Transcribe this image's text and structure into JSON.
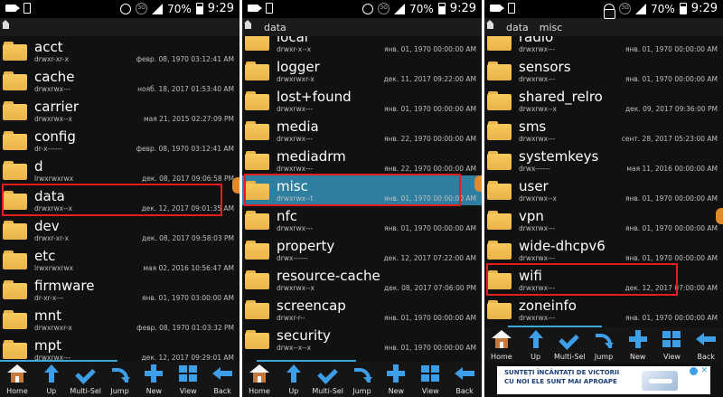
{
  "status": {
    "battery": "70%",
    "time": "9:29",
    "nosig_label": "3G"
  },
  "toolbar": {
    "home": "Home",
    "up": "Up",
    "multisel": "Multi-Sel",
    "jump": "Jump",
    "new": "New",
    "view": "View",
    "back": "Back"
  },
  "panels": [
    {
      "breadcrumbs": [],
      "rows": [
        {
          "name": "acct",
          "perm": "drwxr-xr-x",
          "date": "февр. 08, 1970 03:12:41 AM"
        },
        {
          "name": "cache",
          "perm": "drwxrwx---",
          "date": "нояб. 18, 2017 01:53:40 AM"
        },
        {
          "name": "carrier",
          "perm": "drwxrwx--x",
          "date": "мая 21, 2015 02:27:09 PM"
        },
        {
          "name": "config",
          "perm": "dr-x------",
          "date": "февр. 08, 1970 03:12:41 AM"
        },
        {
          "name": "d",
          "perm": "lrwxrwxrwx",
          "date": "дек. 08, 2017 09:06:58 PM"
        },
        {
          "name": "data",
          "perm": "drwxrwx--x",
          "date": "дек. 12, 2017 09:01:35 AM"
        },
        {
          "name": "dev",
          "perm": "drwxr-xr-x",
          "date": "дек. 08, 2017 09:58:03 PM"
        },
        {
          "name": "etc",
          "perm": "lrwxrwxrwx",
          "date": "мая 02, 2016 10:56:47 AM"
        },
        {
          "name": "firmware",
          "perm": "dr-xr-x---",
          "date": "янв. 01, 1970 03:00:00 AM"
        },
        {
          "name": "mnt",
          "perm": "drwxrwxr-x",
          "date": "февр. 08, 1970 01:03:32 PM"
        },
        {
          "name": "mpt",
          "perm": "drwxrwx---",
          "date": "дек. 12, 2017 09:29:01 AM"
        }
      ]
    },
    {
      "breadcrumbs": [
        "data"
      ],
      "rows": [
        {
          "name": "local",
          "perm": "drwxr-x--x",
          "date": "янв. 01, 1970 00:00:00 AM"
        },
        {
          "name": "logger",
          "perm": "drwxrwxr-x",
          "date": "дек. 11, 2017 09:22:00 AM"
        },
        {
          "name": "lost+found",
          "perm": "drwxrwx---",
          "date": "янв. 01, 1970 00:00:00 AM"
        },
        {
          "name": "media",
          "perm": "drwxrwx---",
          "date": "янв. 22, 1970 00:00:00 AM"
        },
        {
          "name": "mediadrm",
          "perm": "drwxrwx---",
          "date": "янв. 22, 1970 00:00:00 AM"
        },
        {
          "name": "misc",
          "perm": "drwxrwx--t",
          "date": "янв. 01, 1970 00:00:00 AM"
        },
        {
          "name": "nfc",
          "perm": "drwxrwx---",
          "date": "янв. 01, 1970 00:00:00 AM"
        },
        {
          "name": "property",
          "perm": "drwx------",
          "date": "дек. 12, 2017 07:22:00 AM"
        },
        {
          "name": "resource-cache",
          "perm": "drwxrwx--x",
          "date": "дек. 08, 2017 07:06:00 PM"
        },
        {
          "name": "screencap",
          "perm": "drwxr-r--",
          "date": "янв. 01, 1970 00:00:00 AM"
        },
        {
          "name": "security",
          "perm": "drwx--x--x",
          "date": "янв. 01, 1970 00:00:00 AM"
        }
      ]
    },
    {
      "breadcrumbs": [
        "data",
        "misc"
      ],
      "rows": [
        {
          "name": "radio",
          "perm": "drwxrwx---",
          "date": "янв. 01, 1970 00:00:00 AM"
        },
        {
          "name": "sensors",
          "perm": "drwxrwx---",
          "date": "янв. 01, 1970 00:00:00 AM"
        },
        {
          "name": "shared_relro",
          "perm": "drwxrwx--x",
          "date": "дек. 09, 2017 09:36:00 PM"
        },
        {
          "name": "sms",
          "perm": "drwxrwx---",
          "date": "сент. 28, 2017 05:23:00 AM"
        },
        {
          "name": "systemkeys",
          "perm": "drwx------",
          "date": "мая 11, 2016 00:00:00 AM"
        },
        {
          "name": "user",
          "perm": "drwxrwx--x",
          "date": "янв. 01, 1970 00:00:00 AM"
        },
        {
          "name": "vpn",
          "perm": "drwxrwx---",
          "date": "янв. 01, 1970 00:00:00 AM"
        },
        {
          "name": "wide-dhcpv6",
          "perm": "drwxrwx---",
          "date": "янв. 01, 1970 00:00:00 AM"
        },
        {
          "name": "wifi",
          "perm": "drwxrwx---",
          "date": "дек. 12, 2017 07:00:00 AM"
        },
        {
          "name": "zoneinfo",
          "perm": "drwxrwx---",
          "date": "янв. 01, 1970 00:00:00 AM"
        }
      ]
    }
  ],
  "ad": {
    "line1": "SUNTEȚI ÎNCÂNTAȚI DE VICTORII",
    "line2": "CU NOI ELE SUNT MAI APROAPE"
  },
  "colors": {
    "highlight": "#e41e1e",
    "selected_row": "#2e7ea0",
    "icon_blue": "#3d9fe8",
    "folder": "#f5c15a"
  }
}
